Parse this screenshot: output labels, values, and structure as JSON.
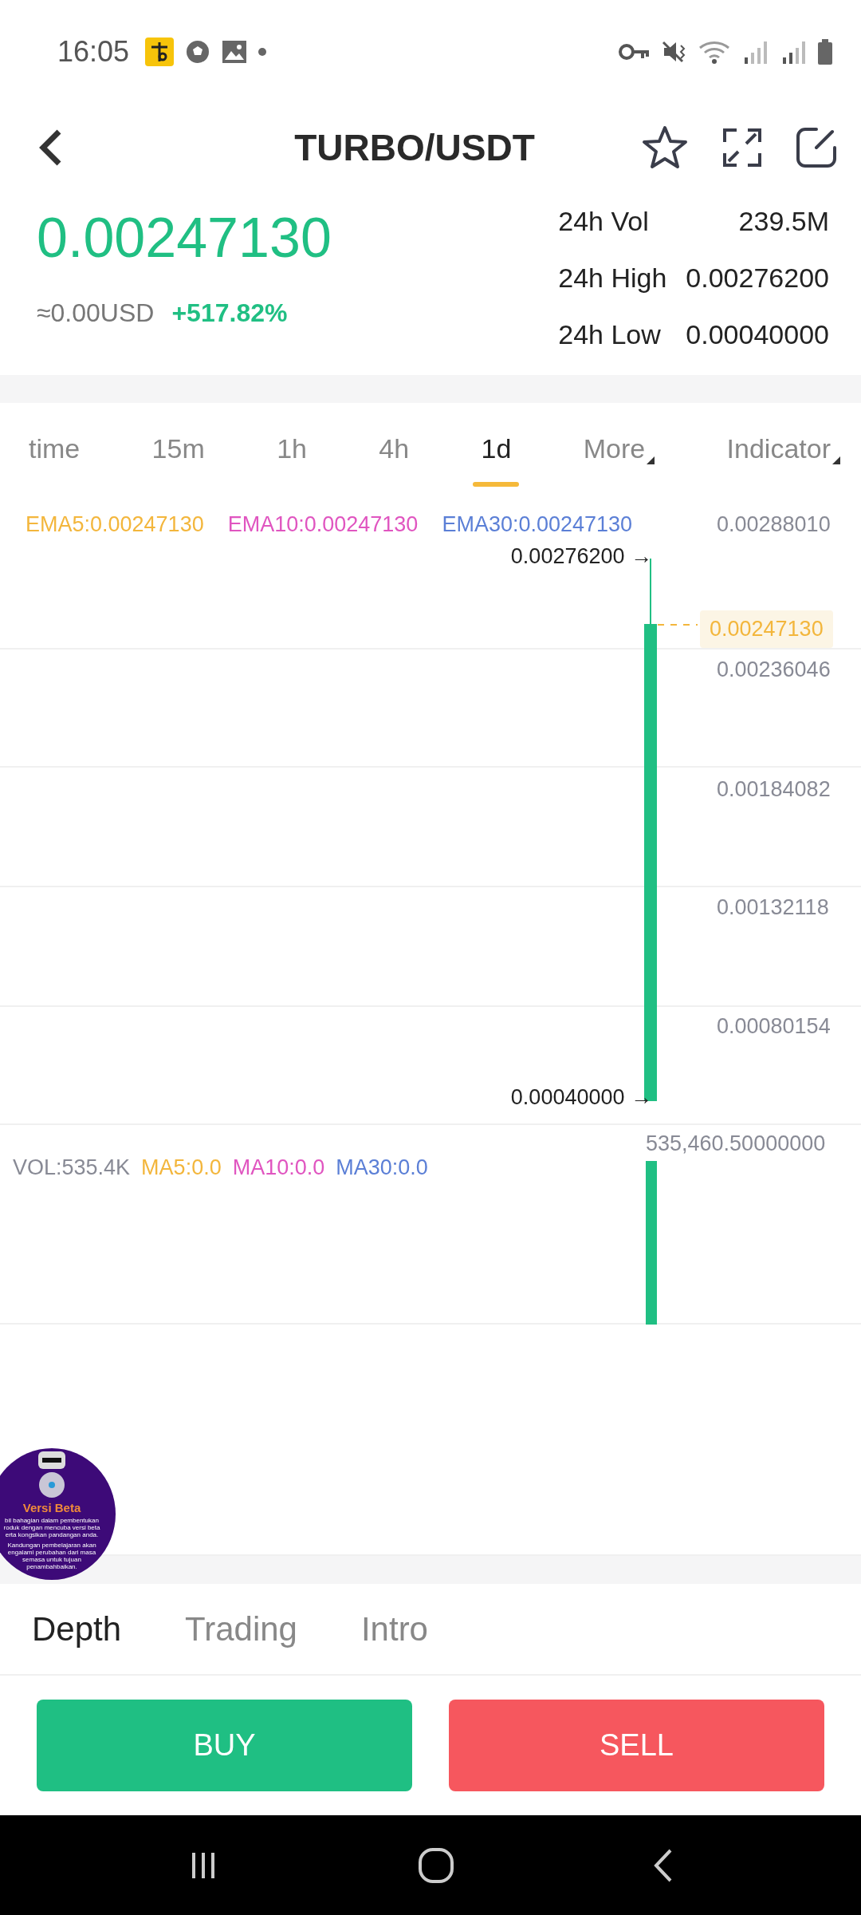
{
  "status_bar": {
    "time": "16:05"
  },
  "header": {
    "title": "TURBO/USDT"
  },
  "ticker": {
    "price": "0.00247130",
    "fiat": "≈0.00USD",
    "change": "+517.82%",
    "stats": [
      {
        "label": "24h Vol",
        "value": "239.5M"
      },
      {
        "label": "24h High",
        "value": "0.00276200"
      },
      {
        "label": "24h Low",
        "value": "0.00040000"
      }
    ]
  },
  "intervals": [
    {
      "label": "time",
      "kind": "interval",
      "selected": false
    },
    {
      "label": "15m",
      "kind": "interval",
      "selected": false
    },
    {
      "label": "1h",
      "kind": "interval",
      "selected": false
    },
    {
      "label": "4h",
      "kind": "interval",
      "selected": false
    },
    {
      "label": "1d",
      "kind": "interval",
      "selected": true
    },
    {
      "label": "More",
      "kind": "dropdown",
      "selected": false
    },
    {
      "label": "Indicator",
      "kind": "dropdown",
      "selected": false
    }
  ],
  "price_chart": {
    "indicators": [
      {
        "label": "EMA5:0.00247130",
        "color": "#f3b63c"
      },
      {
        "label": "EMA10:0.00247130",
        "color": "#e055c0"
      },
      {
        "label": "EMA30:0.00247130",
        "color": "#5b7fd6"
      }
    ],
    "axis_labels": [
      {
        "text": "0.00288010",
        "kind": "tick"
      },
      {
        "text": "0.00247130",
        "kind": "current"
      },
      {
        "text": "0.00236046",
        "kind": "tick"
      },
      {
        "text": "0.00184082",
        "kind": "tick"
      },
      {
        "text": "0.00132118",
        "kind": "tick"
      },
      {
        "text": "0.00080154",
        "kind": "tick"
      }
    ],
    "high_label": "0.00276200 →",
    "low_label": "0.00040000 →"
  },
  "volume_chart": {
    "max_label": "535,460.50000000",
    "indicators": [
      {
        "label": "VOL:535.4K",
        "color": "#888a95"
      },
      {
        "label": "MA5:0.0",
        "color": "#f3b63c"
      },
      {
        "label": "MA10:0.0",
        "color": "#e055c0"
      },
      {
        "label": "MA30:0.0",
        "color": "#5b7fd6"
      }
    ]
  },
  "beta_bubble": {
    "title": "Versi Beta",
    "lines": [
      "bil bahagian dalam pembentukan",
      "roduk dengan mencuba versi beta",
      "erta kongsikan pandangan anda.",
      "Kandungan pembelajaran akan",
      "engalami perubahan dari masa",
      "semasa untuk tujuan",
      "penambahbaikan."
    ]
  },
  "bottom_tabs": [
    {
      "label": "Depth",
      "selected": true
    },
    {
      "label": "Trading",
      "selected": false
    },
    {
      "label": "Intro",
      "selected": false
    }
  ],
  "actions": [
    {
      "label": "BUY",
      "kind": "buy"
    },
    {
      "label": "SELL",
      "kind": "sell"
    }
  ]
}
